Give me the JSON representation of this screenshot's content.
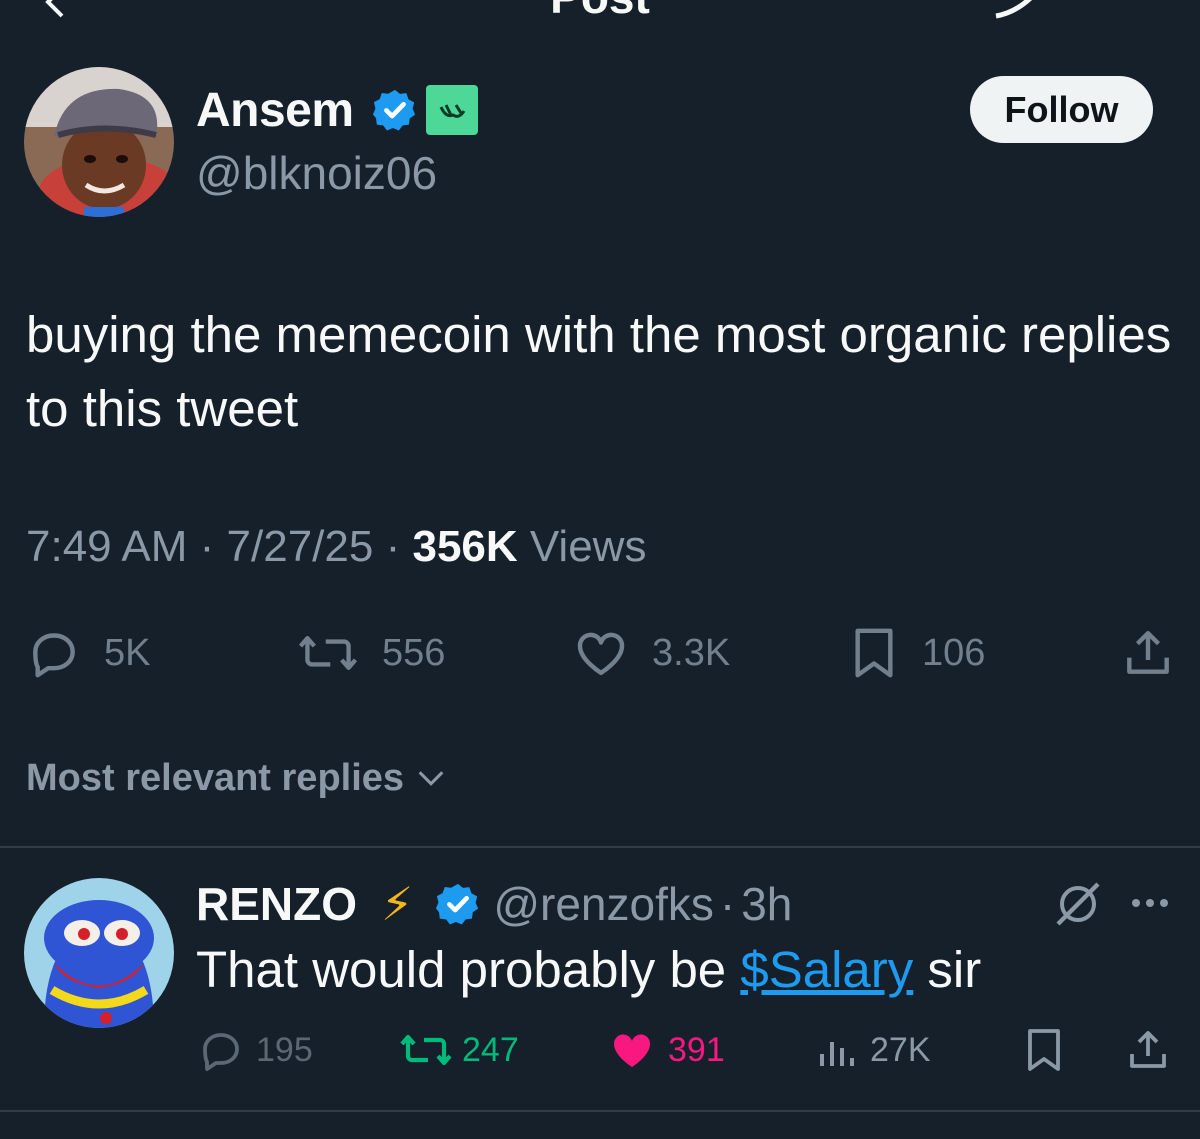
{
  "header": {
    "title": "Post"
  },
  "tweet": {
    "author_name": "Ansem",
    "author_handle": "@blknoiz06",
    "follow_label": "Follow",
    "text": "buying the memecoin with the most organic replies to this tweet",
    "time": "7:49 AM",
    "sep": " · ",
    "date": "7/27/25",
    "views_count": "356K",
    "views_label": " Views",
    "actions": {
      "replies": "5K",
      "reposts": "556",
      "likes": "3.3K",
      "bookmarks": "106"
    }
  },
  "replies_sort": {
    "label": "Most relevant replies"
  },
  "reply": {
    "author_name": "RENZO",
    "emoji": "⚡",
    "author_handle": "@renzofks",
    "dot": "·",
    "time": "3h",
    "text_before": "That would probably be ",
    "cashtag": "$Salary",
    "text_after": " sir",
    "actions": {
      "replies": "195",
      "reposts": "247",
      "likes": "391",
      "views": "27K"
    }
  },
  "colors": {
    "background": "#15202b",
    "accent": "#1d9bf0",
    "repost_active": "#00ba7c",
    "like_active": "#f91880",
    "muted": "#8b98a5",
    "affiliate_badge": "#4ed897"
  }
}
